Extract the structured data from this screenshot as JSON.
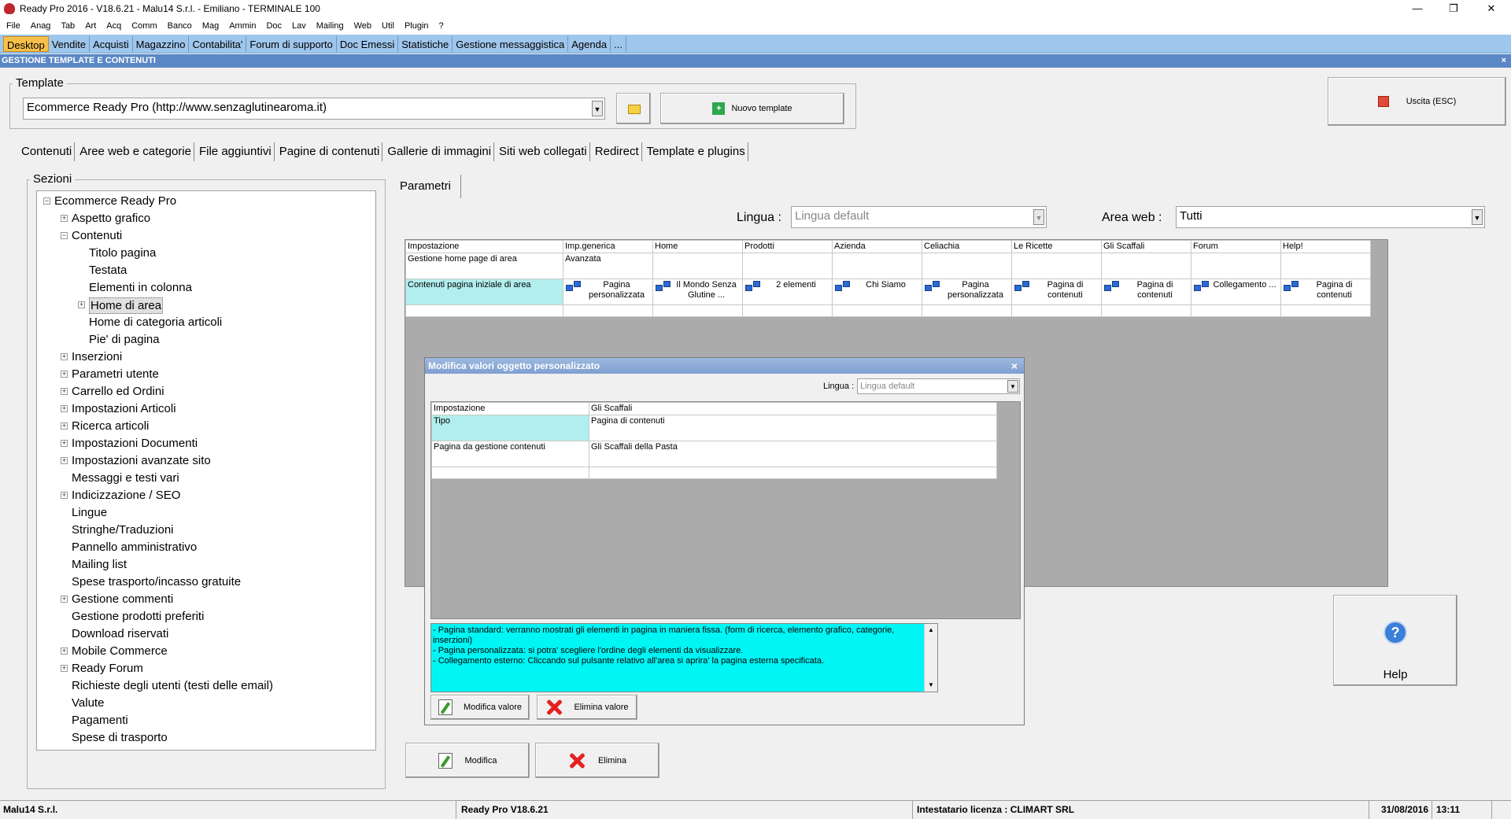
{
  "window": {
    "title": "Ready Pro 2016 - V18.6.21 - Malu14 S.r.l. - Emiliano - TERMINALE 100",
    "minimize": "—",
    "restore": "❐",
    "close": "✕"
  },
  "menu": [
    "File",
    "Anag",
    "Tab",
    "Art",
    "Acq",
    "Comm",
    "Banco",
    "Mag",
    "Ammin",
    "Doc",
    "Lav",
    "Mailing",
    "Web",
    "Util",
    "Plugin",
    "?"
  ],
  "module_tabs": [
    "Desktop",
    "Vendite",
    "Acquisti",
    "Magazzino",
    "Contabilita'",
    "Forum di supporto",
    "Doc Emessi",
    "Statistiche",
    "Gestione messaggistica",
    "Agenda",
    "..."
  ],
  "section_title": "GESTIONE TEMPLATE E CONTENUTI",
  "section_close": "×",
  "template": {
    "legend": "Template",
    "selected": "Ecommerce Ready Pro (http://www.senzaglutinearoma.it)",
    "new_label": "Nuovo template",
    "exit_label": "Uscita (ESC)"
  },
  "content_tabs": [
    "Contenuti",
    "Aree web e categorie",
    "File aggiuntivi",
    "Pagine di contenuti",
    "Gallerie di immagini",
    "Siti web collegati",
    "Redirect",
    "Template e plugins"
  ],
  "sections": {
    "legend": "Sezioni",
    "tree": [
      {
        "label": "Ecommerce Ready Pro",
        "level": 0,
        "exp": "−"
      },
      {
        "label": "Aspetto grafico",
        "level": 1,
        "exp": "+"
      },
      {
        "label": "Contenuti",
        "level": 1,
        "exp": "−"
      },
      {
        "label": "Titolo pagina",
        "level": 2,
        "exp": ""
      },
      {
        "label": "Testata",
        "level": 2,
        "exp": ""
      },
      {
        "label": "Elementi in colonna",
        "level": 2,
        "exp": ""
      },
      {
        "label": "Home di area",
        "level": 2,
        "exp": "+",
        "selected": true
      },
      {
        "label": "Home di categoria articoli",
        "level": 2,
        "exp": ""
      },
      {
        "label": "Pie' di pagina",
        "level": 2,
        "exp": ""
      },
      {
        "label": "Inserzioni",
        "level": 1,
        "exp": "+"
      },
      {
        "label": "Parametri utente",
        "level": 1,
        "exp": "+"
      },
      {
        "label": "Carrello ed Ordini",
        "level": 1,
        "exp": "+"
      },
      {
        "label": "Impostazioni Articoli",
        "level": 1,
        "exp": "+"
      },
      {
        "label": "Ricerca articoli",
        "level": 1,
        "exp": "+"
      },
      {
        "label": "Impostazioni Documenti",
        "level": 1,
        "exp": "+"
      },
      {
        "label": "Impostazioni avanzate sito",
        "level": 1,
        "exp": "+"
      },
      {
        "label": "Messaggi e testi vari",
        "level": 1,
        "exp": ""
      },
      {
        "label": "Indicizzazione / SEO",
        "level": 1,
        "exp": "+"
      },
      {
        "label": "Lingue",
        "level": 1,
        "exp": ""
      },
      {
        "label": "Stringhe/Traduzioni",
        "level": 1,
        "exp": ""
      },
      {
        "label": "Pannello amministrativo",
        "level": 1,
        "exp": ""
      },
      {
        "label": "Mailing list",
        "level": 1,
        "exp": ""
      },
      {
        "label": "Spese trasporto/incasso gratuite",
        "level": 1,
        "exp": ""
      },
      {
        "label": "Gestione commenti",
        "level": 1,
        "exp": "+"
      },
      {
        "label": "Gestione prodotti preferiti",
        "level": 1,
        "exp": ""
      },
      {
        "label": "Download riservati",
        "level": 1,
        "exp": ""
      },
      {
        "label": "Mobile Commerce",
        "level": 1,
        "exp": "+"
      },
      {
        "label": "Ready Forum",
        "level": 1,
        "exp": "+"
      },
      {
        "label": "Richieste degli utenti (testi delle email)",
        "level": 1,
        "exp": ""
      },
      {
        "label": "Valute",
        "level": 1,
        "exp": ""
      },
      {
        "label": "Pagamenti",
        "level": 1,
        "exp": ""
      },
      {
        "label": "Spese di trasporto",
        "level": 1,
        "exp": ""
      }
    ]
  },
  "params": {
    "tab": "Parametri",
    "lingua_label": "Lingua :",
    "lingua_value": "Lingua default",
    "area_label": "Area web :",
    "area_value": "Tutti",
    "columns": [
      "Impostazione",
      "Imp.generica",
      "Home",
      "Prodotti",
      "Azienda",
      "Celiachia",
      "Le Ricette",
      "Gli Scaffali",
      "Forum",
      "Help!"
    ],
    "row1": {
      "label": "Gestione home page di area",
      "generic": "Avanzata"
    },
    "row2": {
      "label": "Contenuti pagina iniziale di area",
      "cells": [
        "Pagina personalizzata",
        "Il Mondo Senza Glutine ...",
        "2 elementi",
        "Chi Siamo",
        "Pagina personalizzata",
        "Pagina di contenuti",
        "Pagina di contenuti",
        "Collegamento ...",
        "Pagina di contenuti"
      ]
    },
    "modify_label": "Modifica",
    "delete_label": "Elimina",
    "help_label": "Help"
  },
  "dialog": {
    "title": "Modifica valori oggetto personalizzato",
    "close": "×",
    "lingua_label": "Lingua :",
    "lingua_value": "Lingua default",
    "columns": [
      "Impostazione",
      "Gli Scaffali"
    ],
    "rows": [
      {
        "label": "Tipo",
        "value": "Pagina di contenuti"
      },
      {
        "label": "Pagina da gestione contenuti",
        "value": "Gli Scaffali della Pasta"
      }
    ],
    "info_lines": [
      "- Pagina standard: verranno mostrati gli elementi in pagina in maniera fissa. (form di ricerca, elemento grafico, categorie, inserzioni)",
      "- Pagina personalizzata: si potra' scegliere l'ordine degli elementi da visualizzare.",
      "- Collegamento esterno: Cliccando sul pulsante relativo all'area si aprira' la pagina esterna specificata."
    ],
    "modify_value_label": "Modifica valore",
    "delete_value_label": "Elimina valore"
  },
  "status": {
    "company": "Malu14 S.r.l.",
    "version": "Ready Pro V18.6.21",
    "license": "Intestatario licenza : CLIMART SRL",
    "date": "31/08/2016",
    "time": "13:11"
  }
}
